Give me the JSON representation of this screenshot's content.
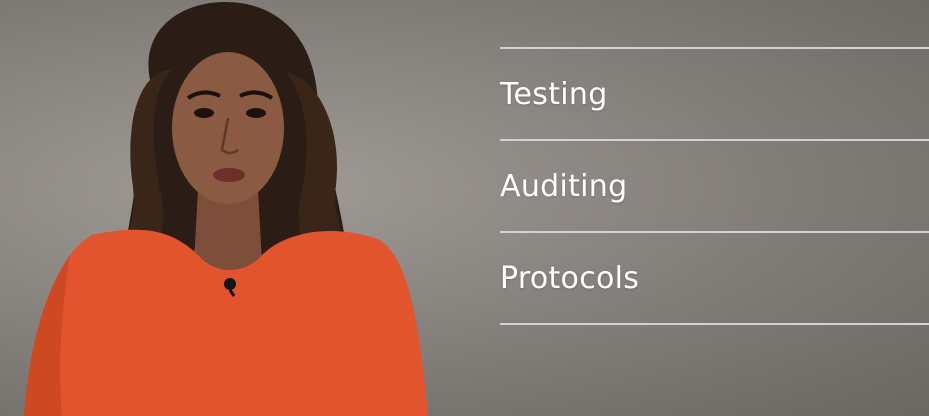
{
  "slide": {
    "items": [
      {
        "label": "Testing"
      },
      {
        "label": "Auditing"
      },
      {
        "label": "Protocols"
      }
    ]
  },
  "colors": {
    "background": "#8a8581",
    "text": "#ffffff",
    "rule": "#d9d7d4",
    "dress": "#e2542e",
    "hair": "#2b1d16",
    "skin": "#8a5a43"
  },
  "presenter": {
    "icon": "presenter-illustration"
  }
}
